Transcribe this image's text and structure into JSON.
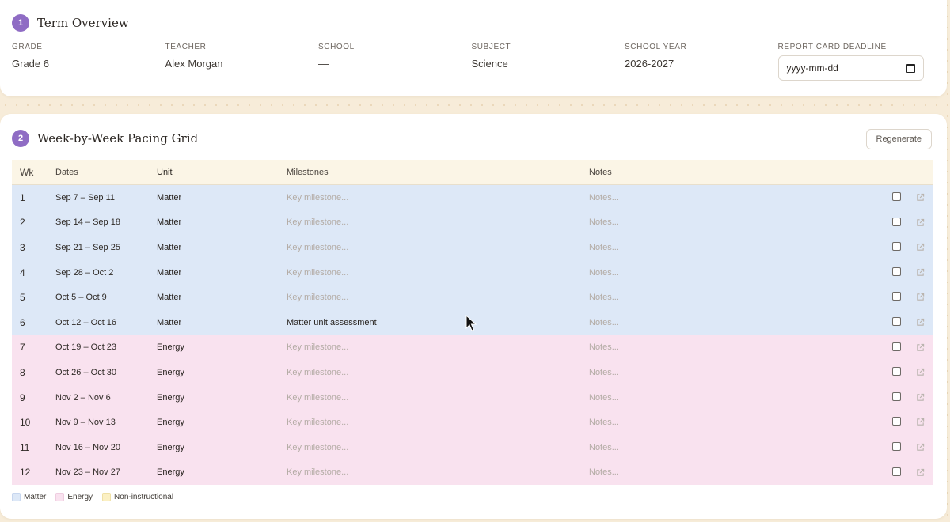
{
  "overview": {
    "step": "1",
    "title": "Term Overview",
    "fields": [
      {
        "label": "GRADE",
        "value": "Grade 6"
      },
      {
        "label": "TEACHER",
        "value": "Alex Morgan"
      },
      {
        "label": "SCHOOL",
        "value": "—"
      },
      {
        "label": "SUBJECT",
        "value": "Science"
      },
      {
        "label": "SCHOOL YEAR",
        "value": "2026-2027"
      }
    ],
    "deadline": {
      "label": "REPORT CARD DEADLINE",
      "placeholder": "yyyy-mm-dd"
    }
  },
  "pacing": {
    "step": "2",
    "title": "Week-by-Week Pacing Grid",
    "regenerate_label": "Regenerate",
    "columns": {
      "wk": "Wk",
      "dates": "Dates",
      "unit": "Unit",
      "milestones": "Milestones",
      "notes": "Notes"
    },
    "placeholders": {
      "milestone": "Key milestone...",
      "notes": "Notes..."
    },
    "rows": [
      {
        "wk": "1",
        "dates": "Sep 7 – Sep 11",
        "unit": "Matter",
        "milestone": "",
        "notes": "",
        "checked": false
      },
      {
        "wk": "2",
        "dates": "Sep 14 – Sep 18",
        "unit": "Matter",
        "milestone": "",
        "notes": "",
        "checked": false
      },
      {
        "wk": "3",
        "dates": "Sep 21 – Sep 25",
        "unit": "Matter",
        "milestone": "",
        "notes": "",
        "checked": false
      },
      {
        "wk": "4",
        "dates": "Sep 28 – Oct 2",
        "unit": "Matter",
        "milestone": "",
        "notes": "",
        "checked": false
      },
      {
        "wk": "5",
        "dates": "Oct 5 – Oct 9",
        "unit": "Matter",
        "milestone": "",
        "notes": "",
        "checked": false
      },
      {
        "wk": "6",
        "dates": "Oct 12 – Oct 16",
        "unit": "Matter",
        "milestone": "Matter unit assessment",
        "notes": "",
        "checked": false
      },
      {
        "wk": "7",
        "dates": "Oct 19 – Oct 23",
        "unit": "Energy",
        "milestone": "",
        "notes": "",
        "checked": false
      },
      {
        "wk": "8",
        "dates": "Oct 26 – Oct 30",
        "unit": "Energy",
        "milestone": "",
        "notes": "",
        "checked": false
      },
      {
        "wk": "9",
        "dates": "Nov 2 – Nov 6",
        "unit": "Energy",
        "milestone": "",
        "notes": "",
        "checked": false
      },
      {
        "wk": "10",
        "dates": "Nov 9 – Nov 13",
        "unit": "Energy",
        "milestone": "",
        "notes": "",
        "checked": false
      },
      {
        "wk": "11",
        "dates": "Nov 16 – Nov 20",
        "unit": "Energy",
        "milestone": "",
        "notes": "",
        "checked": false
      },
      {
        "wk": "12",
        "dates": "Nov 23 – Nov 27",
        "unit": "Energy",
        "milestone": "",
        "notes": "",
        "checked": false
      }
    ],
    "legend": [
      {
        "label": "Matter",
        "color": "#dde8f7"
      },
      {
        "label": "Energy",
        "color": "#f9e2ef"
      },
      {
        "label": "Non-instructional",
        "color": "#fbf0c4"
      }
    ]
  },
  "colors": {
    "accent": "#8f6cc4",
    "matter": "#dde8f7",
    "energy": "#f9e2ef",
    "non_instructional": "#fbf0c4"
  }
}
